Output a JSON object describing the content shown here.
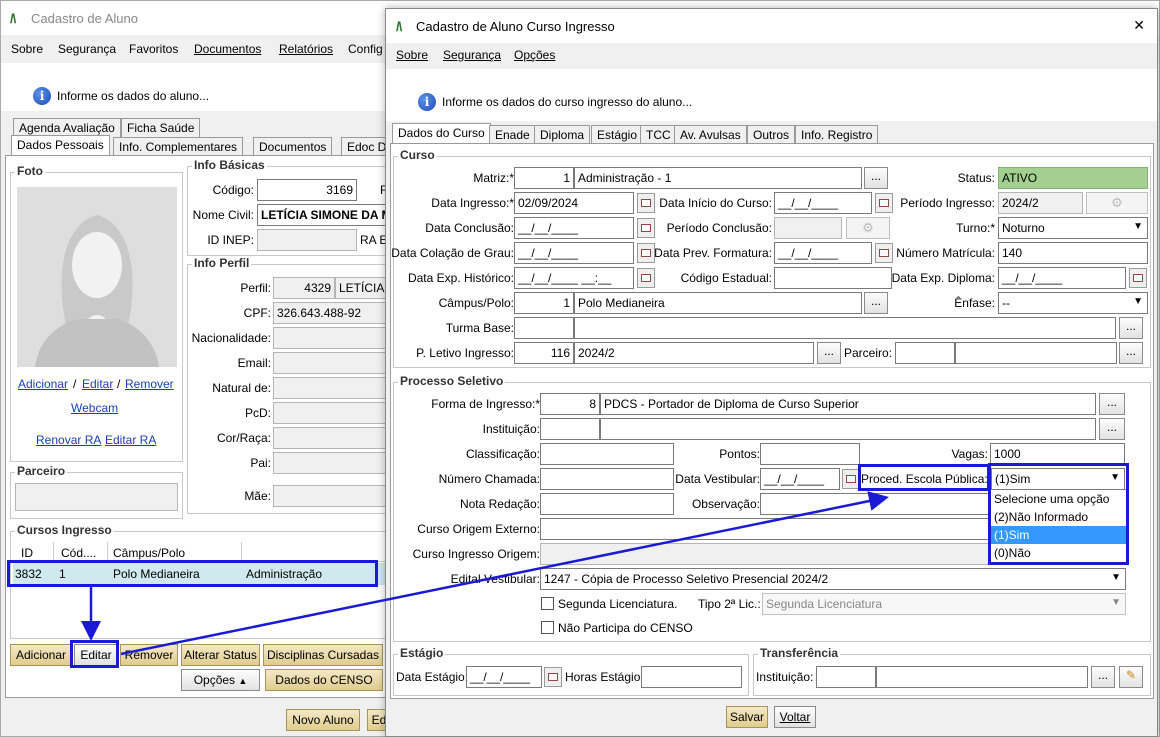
{
  "back": {
    "title": "Cadastro de Aluno",
    "logo": "/\\",
    "menu": [
      "Sobre",
      "Segurança",
      "Favoritos",
      "Documentos",
      "Relatórios",
      "Config"
    ],
    "info": "Informe os dados do aluno...",
    "tabs_row1": [
      "Agenda Avaliação",
      "Ficha Saúde"
    ],
    "tabs_row2": [
      "Dados Pessoais",
      "Info. Complementares",
      "Documentos",
      "Edoc D"
    ],
    "foto": {
      "title": "Foto",
      "add": "Adicionar",
      "edit": "Editar",
      "remove": "Remover",
      "sep": "/",
      "webcam": "Webcam",
      "renovar": "Renovar RA",
      "editar_ra": "Editar RA"
    },
    "parceiro_title": "Parceiro",
    "info_basicas": {
      "title": "Info Básicas",
      "codigo_label": "Código:",
      "codigo": "3169",
      "ra_label": "RA",
      "nome_label": "Nome Civil:",
      "nome": "LETÍCIA SIMONE DA MO",
      "inep_label": "ID INEP:",
      "ra_es_label": "RA Es"
    },
    "info_perfil": {
      "title": "Info Perfil",
      "perfil_label": "Perfil:",
      "perfil_id": "4329",
      "perfil_nome": "LETÍCIA SI",
      "cpf_label": "CPF:",
      "cpf": "326.643.488-92",
      "nac_label": "Nacionalidade:",
      "email_label": "Email:",
      "natural_label": "Natural de:",
      "pcd_label": "PcD:",
      "cor_label": "Cor/Raça:",
      "pai_label": "Pai:",
      "mae_label": "Mãe:"
    },
    "cursos": {
      "title": "Cursos Ingresso",
      "columns": [
        "ID",
        "Cód....",
        "Câmpus/Polo"
      ],
      "row": {
        "id": "3832",
        "cod": "1",
        "campus": "Polo Medianeira",
        "curso": "Administração"
      }
    },
    "buttons": {
      "adicionar": "Adicionar",
      "editar": "Editar",
      "remover": "Remover",
      "alterar": "Alterar Status",
      "disciplinas": "Disciplinas Cursadas",
      "opcoes": "Opções",
      "censo": "Dados do CENSO",
      "novo": "Novo Aluno",
      "ed": "Ed"
    }
  },
  "front": {
    "title": "Cadastro de Aluno Curso Ingresso",
    "logo": "/\\",
    "close": "✕",
    "menu": [
      "Sobre",
      "Segurança",
      "Opções"
    ],
    "info": "Informe os dados do curso ingresso do aluno...",
    "tabs": [
      "Dados do Curso",
      "Enade",
      "Diploma",
      "Estágio",
      "TCC",
      "Av. Avulsas",
      "Outros",
      "Info. Registro"
    ],
    "curso": {
      "title": "Curso",
      "matriz_label": "Matriz:*",
      "matriz_id": "1",
      "matriz_nome": "Administração - 1",
      "status_label": "Status:",
      "status": "ATIVO",
      "data_ingresso_label": "Data Ingresso:*",
      "data_ingresso": "02/09/2024",
      "data_inicio_label": "Data Início do Curso:",
      "data_inicio": "__/__/____",
      "periodo_ingresso_label": "Período Ingresso:",
      "periodo_ingresso": "2024/2",
      "data_conclusao_label": "Data Conclusão:",
      "data_conclusao": "__/__/____",
      "periodo_conclusao_label": "Período Conclusão:",
      "turno_label": "Turno:*",
      "turno": "Noturno",
      "colacao_label": "Data Colação de Grau:",
      "colacao": "__/__/____",
      "prev_formatura_label": "Data Prev. Formatura:",
      "prev_formatura": "__/__/____",
      "matricula_label": "Número Matrícula:",
      "matricula": "140",
      "exp_historico_label": "Data Exp. Histórico:",
      "exp_historico": "__/__/____ __:__",
      "cod_estadual_label": "Código Estadual:",
      "exp_diploma_label": "Data Exp. Diploma:",
      "exp_diploma": "__/__/____",
      "campus_label": "Câmpus/Polo:",
      "campus_id": "1",
      "campus_nome": "Polo Medianeira",
      "enfase_label": "Ênfase:",
      "enfase": "--",
      "turma_label": "Turma Base:",
      "letivo_label": "P. Letivo Ingresso:",
      "letivo_id": "116",
      "letivo": "2024/2",
      "parceiro_label": "Parceiro:"
    },
    "processo": {
      "title": "Processo Seletivo",
      "forma_label": "Forma de Ingresso:*",
      "forma_id": "8",
      "forma": "PDCS - Portador de Diploma de Curso Superior",
      "instituicao_label": "Instituição:",
      "classificacao_label": "Classificação:",
      "pontos_label": "Pontos:",
      "vagas_label": "Vagas:",
      "vagas": "1000",
      "chamada_label": "Número Chamada:",
      "vestibular_label": "Data Vestibular:",
      "vestibular": "__/__/____",
      "escola_label": "Proced. Escola Pública:*",
      "escola": "(1)Sim",
      "escola_options": [
        "Selecione uma opção",
        "(2)Não Informado",
        "(1)Sim",
        "(0)Não"
      ],
      "redacao_label": "Nota Redação:",
      "observacao_label": "Observação:",
      "origem_externo_label": "Curso Origem Externo:",
      "ingresso_origem_label": "Curso Ingresso Origem:",
      "edital_label": "Edital Vestibular:",
      "edital": "1247 - Cópia de Processo Seletivo Presencial 2024/2",
      "segunda_label": "Segunda Licenciatura.",
      "tipo2_label": "Tipo 2ª Lic.:",
      "tipo2": "Segunda Licenciatura",
      "censo_label": "Não Participa do CENSO"
    },
    "estagio": {
      "title": "Estágio",
      "data_label": "Data Estágio:",
      "data": "__/__/____",
      "horas_label": "Horas Estágio:"
    },
    "transferencia": {
      "title": "Transferência",
      "instituicao_label": "Instituição:"
    },
    "salvar": "Salvar",
    "voltar": "Voltar"
  },
  "colors": {
    "status_bg": "#a3cf8f",
    "highlight": "#1a1ad6",
    "selected_option": "#3399ff",
    "button_gold": "#e6d49c"
  }
}
